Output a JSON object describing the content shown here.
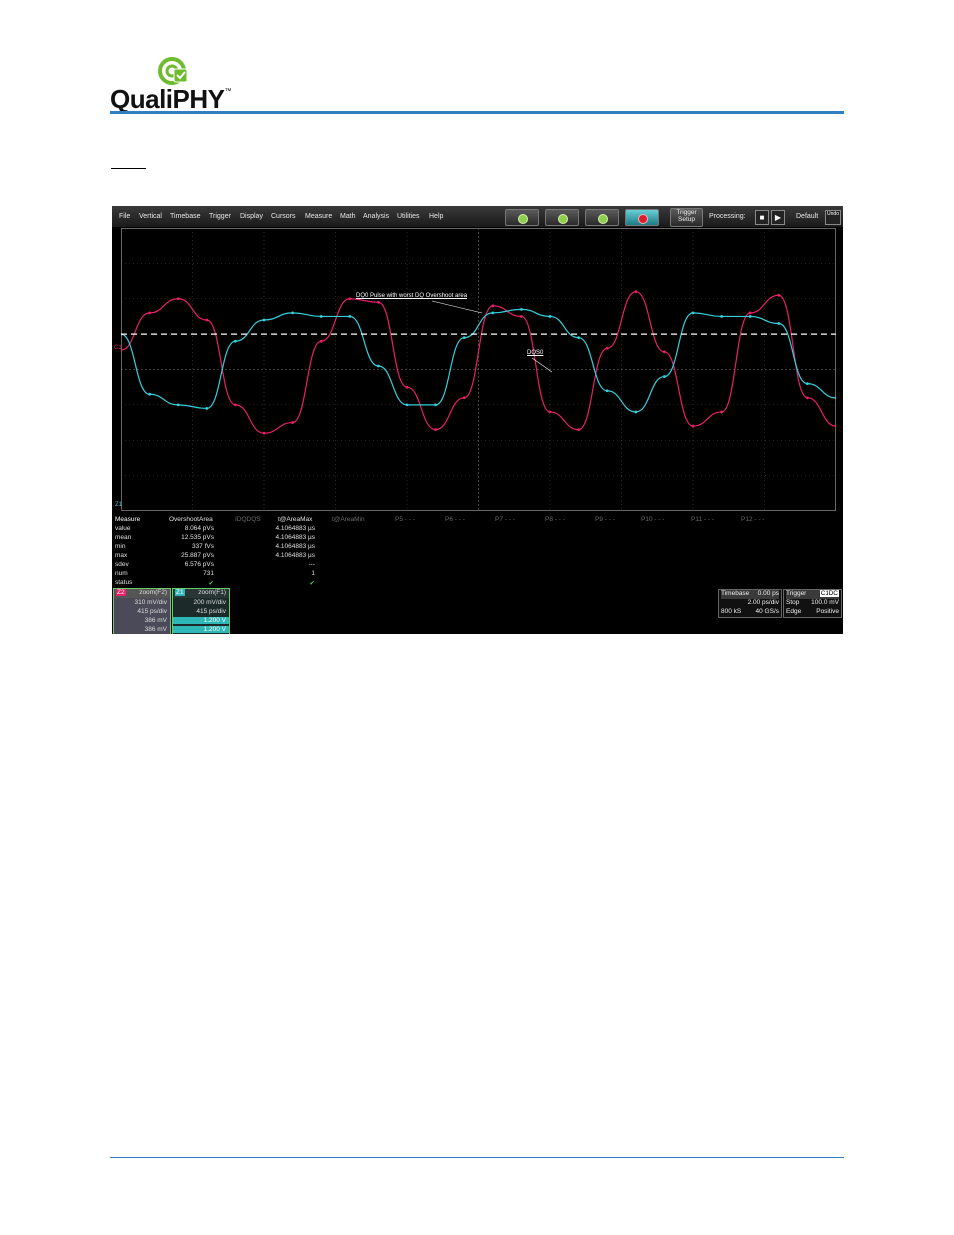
{
  "header": {
    "logo_text": "QualiPHY",
    "logo_tm": "™"
  },
  "colors": {
    "accent": "#2f7fc1",
    "trace_cyan": "#35d0dc",
    "trace_magenta": "#e8206a",
    "logo_green": "#6dbb2e"
  },
  "menu": [
    "File",
    "Vertical",
    "Timebase",
    "Trigger",
    "Display",
    "Cursors",
    "Measure",
    "Math",
    "Analysis",
    "Utilities",
    "Help"
  ],
  "toolbar": {
    "trigger_label_1": "Trigger",
    "trigger_label_2": "Setup",
    "processing_label": "Processing:",
    "default_label": "Default",
    "undo_label": "Undo",
    "stop_icon": "stop-icon",
    "play_icon": "play-icon"
  },
  "annotations": {
    "overshoot": "DQ0 Pulse with worst DQ Overshoot area",
    "dq": "DQS0"
  },
  "markers": {
    "c1": "C1",
    "z1": "Z1"
  },
  "measure": {
    "header": "Measure",
    "columns": [
      "OvershootArea",
      "IDQDQS",
      "t@AreaMax",
      "t@AreaMin",
      "P5 - - -",
      "P6 - - -",
      "P7 - - -",
      "P8 - - -",
      "P9 - - -",
      "P10 - - -",
      "P11 - - -",
      "P12 - - -"
    ],
    "rows": [
      {
        "label": "value",
        "c1": "8.064 pVs",
        "c3": "4.1064883 µs"
      },
      {
        "label": "mean",
        "c1": "12.535 pVs",
        "c3": "4.1064883 µs"
      },
      {
        "label": "min",
        "c1": "337 fVs",
        "c3": "4.1064883 µs"
      },
      {
        "label": "max",
        "c1": "25.887 pVs",
        "c3": "4.1064883 µs"
      },
      {
        "label": "sdev",
        "c1": "6.576 pVs",
        "c3": "---"
      },
      {
        "label": "num",
        "c1": "731",
        "c3": "1"
      },
      {
        "label": "status",
        "c1": "✔",
        "c3": "✔"
      }
    ]
  },
  "channels": [
    {
      "tag": "Z2",
      "title": "zoom(F2)",
      "l1": "310 mV/div",
      "l2": "415 ps/div",
      "l3": "386 mV",
      "l4": "386 mV"
    },
    {
      "tag": "Z1",
      "title": "zoom(F1)",
      "l1": "200 mV/div",
      "l2": "415 ps/div",
      "l3": "1.200 V",
      "l4": "1.200 V"
    }
  ],
  "timebase": {
    "label": "Timebase",
    "value": "0.00 ps",
    "div": "2.00 ps/div",
    "samples": "800 kS",
    "rate": "40 GS/s"
  },
  "trigger": {
    "label": "Trigger",
    "ch": "C1",
    "cpl": "DC",
    "mode": "Stop",
    "level": "100.0 mV",
    "type": "Edge",
    "slope": "Positive"
  },
  "chart_data": {
    "type": "line",
    "title": "",
    "series": [
      {
        "name": "DQ0",
        "color": "#e8206a",
        "x": [
          0,
          4,
          8,
          12,
          16,
          20,
          24,
          28,
          32,
          36,
          40,
          44,
          48,
          52,
          56,
          60,
          64,
          68,
          72,
          76,
          80,
          84,
          88,
          92,
          96,
          100
        ],
        "values": [
          0.55,
          1.6,
          2.0,
          1.4,
          -1.0,
          -1.8,
          -1.5,
          0.8,
          2.0,
          1.9,
          -0.5,
          -1.7,
          -0.8,
          1.8,
          1.5,
          -1.2,
          -1.7,
          0.6,
          2.2,
          0.5,
          -1.6,
          -1.2,
          1.6,
          2.1,
          -0.8,
          -1.6
        ]
      },
      {
        "name": "DQS0",
        "color": "#35d0dc",
        "x": [
          0,
          4,
          8,
          12,
          16,
          20,
          24,
          28,
          32,
          36,
          40,
          44,
          48,
          52,
          56,
          60,
          64,
          68,
          72,
          76,
          80,
          84,
          88,
          92,
          96,
          100
        ],
        "values": [
          1.0,
          -0.7,
          -1.0,
          -1.1,
          0.8,
          1.4,
          1.6,
          1.5,
          1.5,
          0.1,
          -1.0,
          -1.0,
          0.9,
          1.6,
          1.7,
          1.5,
          0.9,
          -0.6,
          -1.2,
          -0.2,
          1.6,
          1.5,
          1.5,
          1.3,
          -0.4,
          -0.8
        ]
      }
    ],
    "reference_line": 1.0,
    "grid": true
  }
}
